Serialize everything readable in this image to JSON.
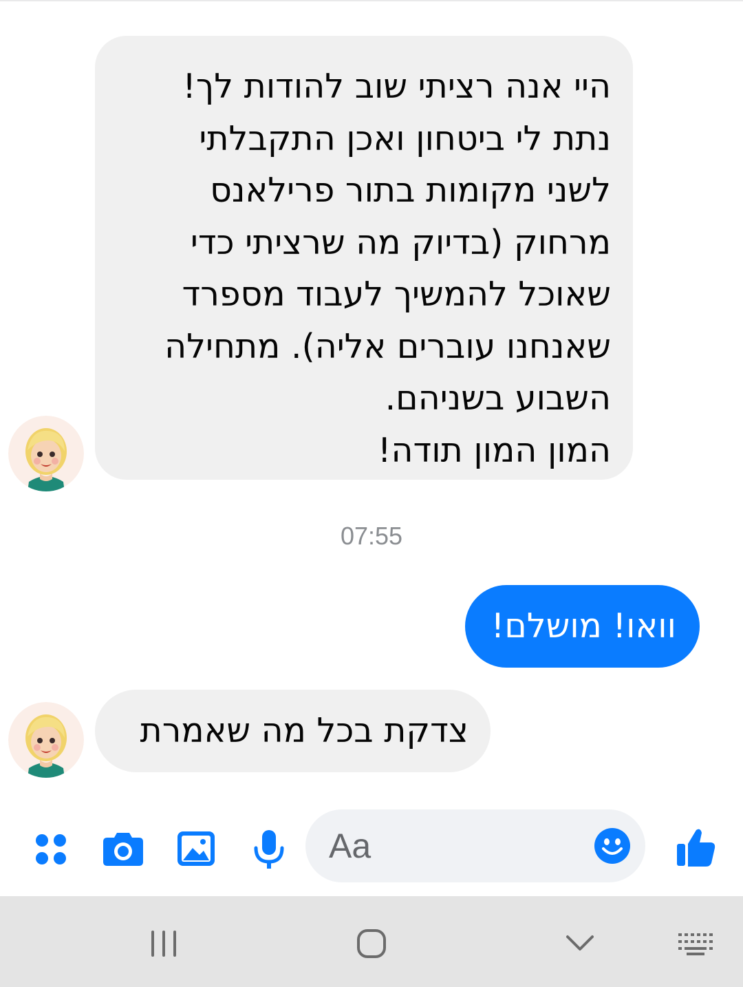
{
  "conversation": {
    "messages": [
      {
        "sender": "contact",
        "lines": [
          "היי אנה רציתי שוב להודות לך!",
          "נתת לי ביטחון ואכן התקבלתי",
          "לשני מקומות בתור פרילאנס",
          "מרחוק (בדיוק מה שרציתי כדי",
          "שאוכל להמשיך לעבוד מספרד",
          "שאנחנו עוברים אליה). מתחילה",
          "השבוע בשניהם.",
          "המון המון תודה!"
        ]
      },
      {
        "sender": "me",
        "text": "וואו! מושלם!"
      },
      {
        "sender": "contact",
        "text": "צדקת בכל מה שאמרת"
      }
    ],
    "timestamp": "07:55"
  },
  "composer": {
    "placeholder": "Aa",
    "icons": [
      "apps-icon",
      "camera-icon",
      "gallery-icon",
      "microphone-icon",
      "emoji-icon",
      "thumbs-up-icon"
    ]
  },
  "colors": {
    "accent": "#0a7cff",
    "incoming_bubble": "#f0f0f0",
    "navbar": "#e4e4e4"
  },
  "system_nav": {
    "buttons": [
      "recent-apps",
      "home",
      "back",
      "keyboard"
    ]
  }
}
